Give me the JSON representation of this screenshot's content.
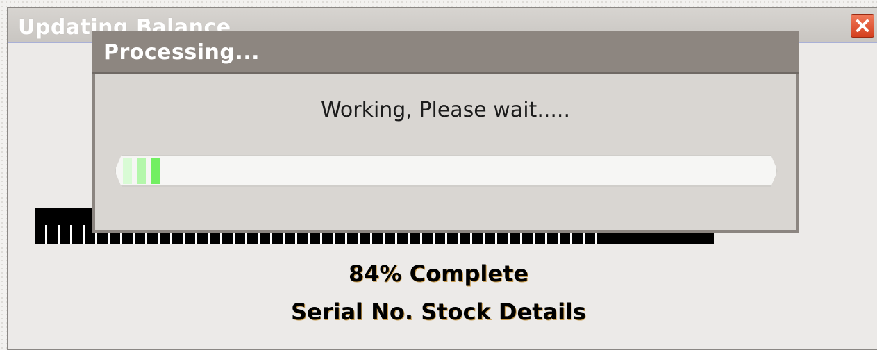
{
  "outer_window": {
    "title": "Updating Balance",
    "close_button_label": "×"
  },
  "status": {
    "percent_complete": 84,
    "percent_text": "84% Complete",
    "current_task": "Serial No. Stock Details"
  },
  "processing_dialog": {
    "title": "Processing...",
    "message": "Working, Please wait.....",
    "indeterminate_progress": true
  },
  "icons": {
    "close": "close-icon"
  },
  "colors": {
    "close_button": "#d4401f",
    "progress_chunk": "#72ef62",
    "dialog_titlebar": "#8d8680",
    "status_text": "#000000"
  }
}
